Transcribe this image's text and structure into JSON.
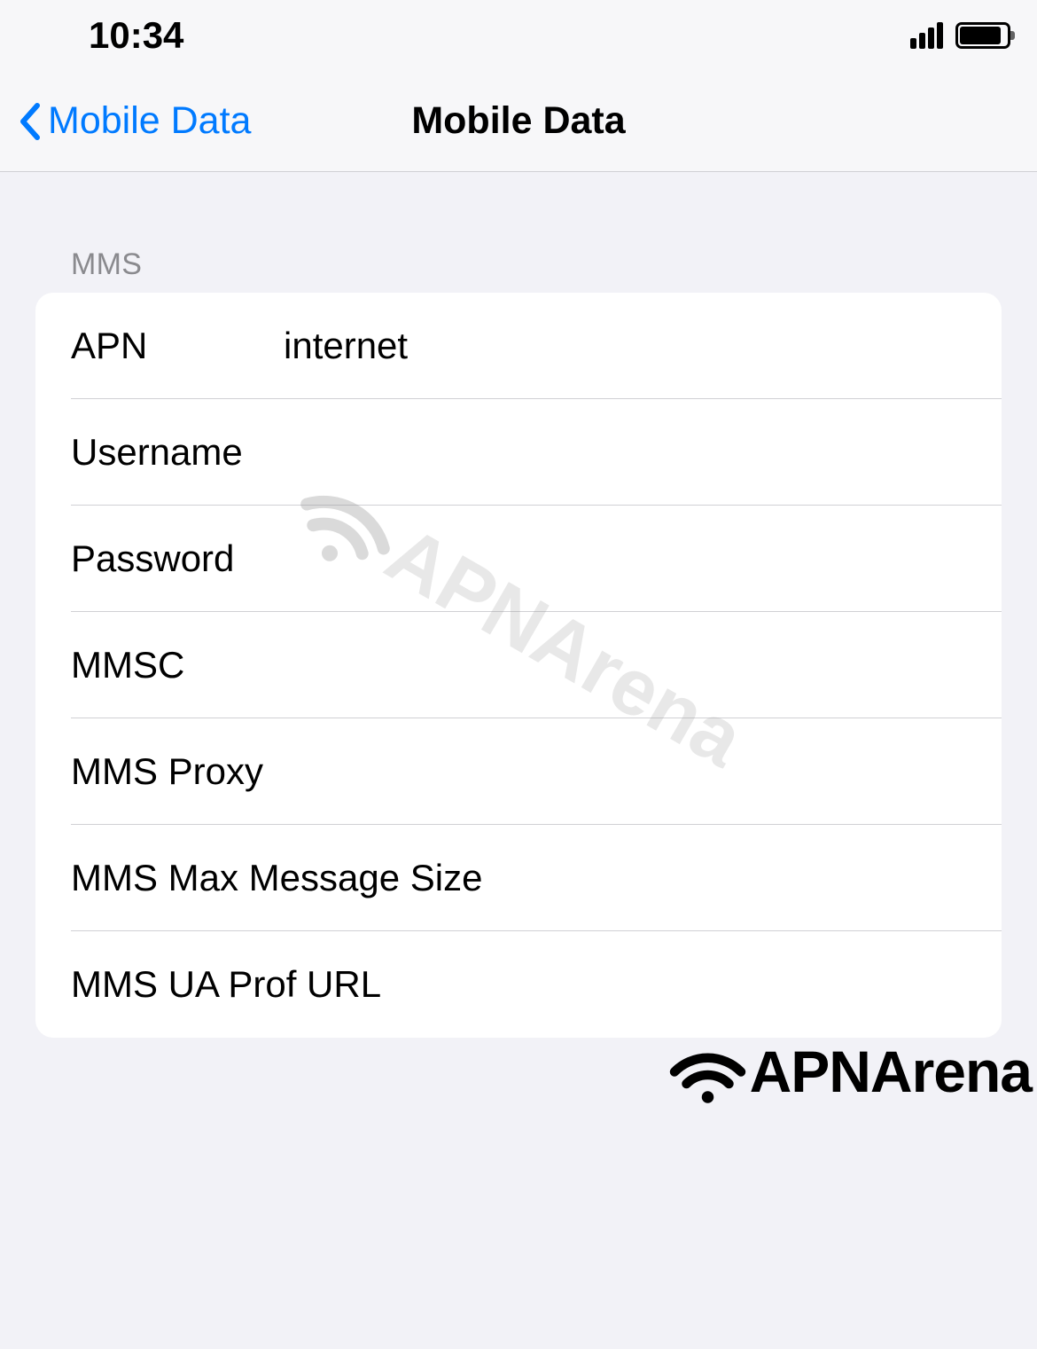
{
  "status": {
    "time": "10:34"
  },
  "nav": {
    "back_label": "Mobile Data",
    "title": "Mobile Data"
  },
  "section": {
    "header": "MMS"
  },
  "fields": [
    {
      "label": "APN",
      "value": "internet"
    },
    {
      "label": "Username",
      "value": ""
    },
    {
      "label": "Password",
      "value": ""
    },
    {
      "label": "MMSC",
      "value": ""
    },
    {
      "label": "MMS Proxy",
      "value": ""
    },
    {
      "label": "MMS Max Message Size",
      "value": ""
    },
    {
      "label": "MMS UA Prof URL",
      "value": ""
    }
  ],
  "watermark": {
    "text": "APNArena"
  },
  "branding": {
    "text": "APNArena"
  }
}
